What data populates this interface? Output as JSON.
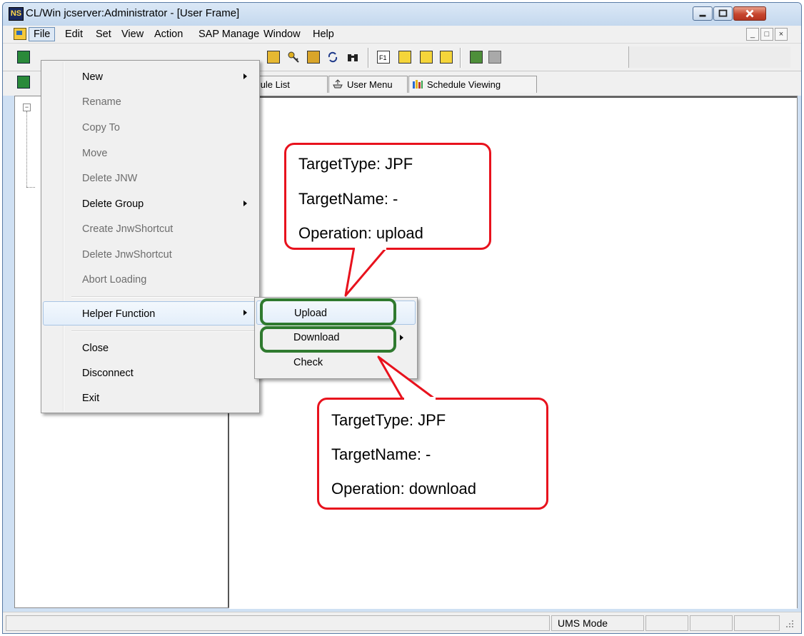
{
  "window": {
    "title": "CL/Win jcserver:Administrator - [User Frame]",
    "app_icon_text": "NS"
  },
  "menubar": {
    "items": [
      "File",
      "Edit",
      "Set",
      "View",
      "Action",
      "SAP Manage",
      "Window",
      "Help"
    ],
    "active": "File"
  },
  "tabs": [
    {
      "label": "hedule List",
      "icon": "schedule-list-icon"
    },
    {
      "label": "User Menu",
      "icon": "user-menu-icon"
    },
    {
      "label": "Schedule Viewing",
      "icon": "schedule-viewing-icon"
    }
  ],
  "file_menu": {
    "items": [
      {
        "label": "New",
        "enabled": true,
        "submenu": true
      },
      {
        "label": "Rename",
        "enabled": false
      },
      {
        "label": "Copy To",
        "enabled": false
      },
      {
        "label": "Move",
        "enabled": false
      },
      {
        "label": "Delete JNW",
        "enabled": false
      },
      {
        "label": "Delete Group",
        "enabled": true,
        "submenu": true
      },
      {
        "label": "Create JnwShortcut",
        "enabled": false
      },
      {
        "label": "Delete JnwShortcut",
        "enabled": false
      },
      {
        "label": "Abort Loading",
        "enabled": false
      },
      {
        "label": "Helper Function",
        "enabled": true,
        "submenu": true,
        "highlighted": true
      },
      {
        "label": "Close",
        "enabled": true
      },
      {
        "label": "Disconnect",
        "enabled": true
      },
      {
        "label": "Exit",
        "enabled": true
      }
    ]
  },
  "helper_submenu": {
    "items": [
      {
        "label": "Upload",
        "highlighted": true
      },
      {
        "label": "Download",
        "submenu": true
      },
      {
        "label": "Check"
      }
    ]
  },
  "callouts": {
    "upload": [
      "TargetType: JPF",
      "TargetName: -",
      "Operation: upload"
    ],
    "download": [
      "TargetType: JPF",
      "TargetName: -",
      "Operation: download"
    ]
  },
  "statusbar": {
    "mode": "UMS Mode"
  },
  "colors": {
    "callout_border": "#e8121d",
    "highlight_box": "#2f7a2f",
    "menu_highlight": "#dde8f5"
  }
}
